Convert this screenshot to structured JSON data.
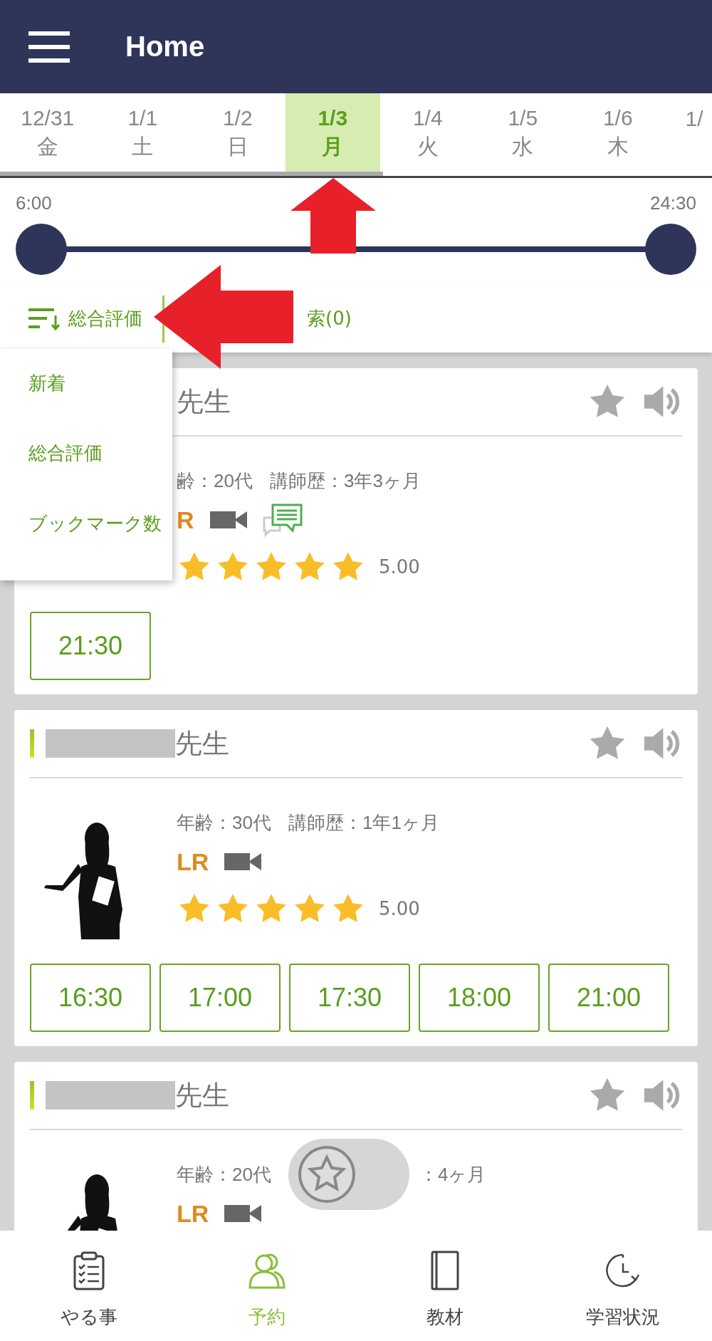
{
  "header": {
    "title": "Home"
  },
  "dates": [
    {
      "date": "12/31",
      "day": "金",
      "selected": false
    },
    {
      "date": "1/1",
      "day": "土",
      "selected": false
    },
    {
      "date": "1/2",
      "day": "日",
      "selected": false
    },
    {
      "date": "1/3",
      "day": "月",
      "selected": true
    },
    {
      "date": "1/4",
      "day": "火",
      "selected": false
    },
    {
      "date": "1/5",
      "day": "水",
      "selected": false
    },
    {
      "date": "1/6",
      "day": "木",
      "selected": false
    },
    {
      "date": "1/",
      "selected": false
    }
  ],
  "time_range": {
    "start": "6:00",
    "end": "24:30",
    "level": 1
  },
  "sort": {
    "label": "総合評価"
  },
  "search": {
    "label": "索(0)"
  },
  "sort_menu": [
    {
      "label": "新着"
    },
    {
      "label": "総合評価"
    },
    {
      "label": "ブックマーク数"
    }
  ],
  "cards": [
    {
      "redacted": false,
      "name": "先生",
      "photo": false,
      "info": [
        "齢：20代",
        "講師歴：3年3ヶ月"
      ],
      "badge": "R",
      "icons": [
        {
          "kind": "video"
        },
        {
          "kind": "chat"
        }
      ],
      "stars": 5,
      "rating": "5.00",
      "slots": [
        "21:30"
      ]
    },
    {
      "redacted": true,
      "name": "先生",
      "photo": true,
      "info": [
        "年齢：30代",
        "講師歴：1年1ヶ月"
      ],
      "badge": "LR",
      "icons": [
        {
          "kind": "video"
        }
      ],
      "stars": 5,
      "rating": "5.00",
      "slots": [
        "16:30",
        "17:00",
        "17:30",
        "18:00",
        "21:00"
      ]
    },
    {
      "redacted": true,
      "name": "先生",
      "photo": true,
      "info": [
        "年齢：20代",
        "：4ヶ月"
      ],
      "floating_favorite": true,
      "badge": "LR",
      "icons": [
        {
          "kind": "video"
        }
      ]
    }
  ],
  "nav": [
    {
      "label": "やる事",
      "kind": "clipboard",
      "selected": false
    },
    {
      "label": "予約",
      "kind": "people",
      "selected": true
    },
    {
      "label": "教材",
      "kind": "book",
      "selected": false
    },
    {
      "label": "学習状況",
      "kind": "clock",
      "selected": false
    }
  ],
  "annotations": [
    {
      "kind": "up_arrow"
    },
    {
      "kind": "left_arrow"
    }
  ]
}
